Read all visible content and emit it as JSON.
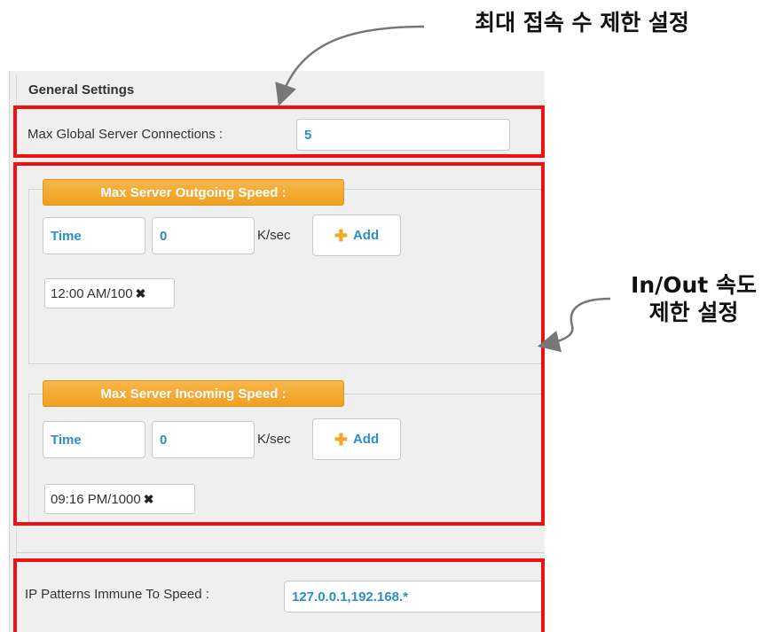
{
  "annotations": {
    "top_callout": "최대 접속 수 제한 설정",
    "side_callout_line1": "In/Out 속도",
    "side_callout_line2": "제한 설정"
  },
  "settings": {
    "section_title": "General Settings",
    "max_connections_label": "Max Global Server Connections :",
    "max_connections_value": "5",
    "outgoing": {
      "legend": "Max Server Outgoing Speed :",
      "time_value": "Time",
      "speed_value": "0",
      "unit": "K/sec",
      "add_label": "Add",
      "entries": [
        "12:00 AM/100"
      ]
    },
    "incoming": {
      "legend": "Max Server Incoming Speed :",
      "time_value": "Time",
      "speed_value": "0",
      "unit": "K/sec",
      "add_label": "Add",
      "entries": [
        "09:16 PM/1000"
      ]
    },
    "ip_label": "IP Patterns Immune To Speed :",
    "ip_value": "127.0.0.1,192.168.*"
  },
  "colors": {
    "highlight": "#ee1111",
    "legend": "#f5a623",
    "value_text": "#2a8fc6"
  }
}
